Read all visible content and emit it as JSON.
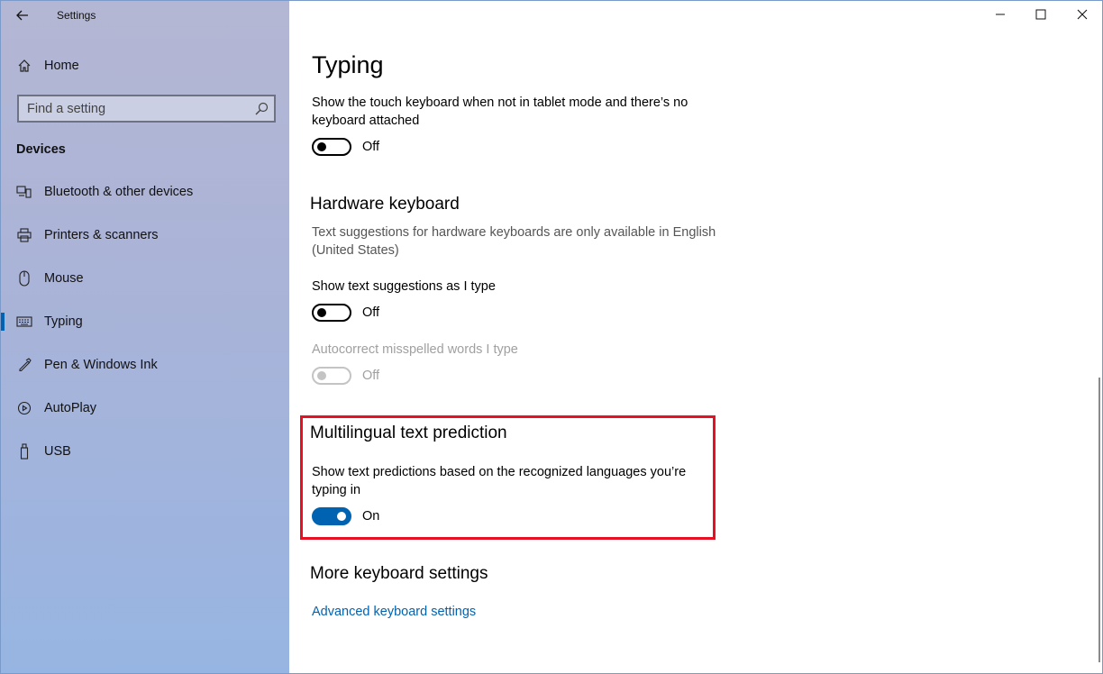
{
  "window": {
    "title": "Settings"
  },
  "sidebar": {
    "home_label": "Home",
    "search_placeholder": "Find a setting",
    "section": "Devices",
    "items": [
      {
        "label": "Bluetooth & other devices",
        "icon": "bluetooth-icon"
      },
      {
        "label": "Printers & scanners",
        "icon": "printer-icon"
      },
      {
        "label": "Mouse",
        "icon": "mouse-icon"
      },
      {
        "label": "Typing",
        "icon": "keyboard-icon",
        "active": true
      },
      {
        "label": "Pen & Windows Ink",
        "icon": "pen-icon"
      },
      {
        "label": "AutoPlay",
        "icon": "autoplay-icon"
      },
      {
        "label": "USB",
        "icon": "usb-icon"
      }
    ]
  },
  "content": {
    "title": "Typing",
    "touch_keyboard": {
      "description": "Show the touch keyboard when not in tablet mode and there’s no keyboard attached",
      "state": "Off"
    },
    "hardware_keyboard": {
      "heading": "Hardware keyboard",
      "note": "Text suggestions for hardware keyboards are only available in English (United States)",
      "suggestions_label": "Show text suggestions as I type",
      "suggestions_state": "Off",
      "autocorrect_label": "Autocorrect misspelled words I type",
      "autocorrect_state": "Off"
    },
    "multilingual": {
      "heading": "Multilingual text prediction",
      "description": "Show text predictions based on the recognized languages you’re typing in",
      "state": "On"
    },
    "more": {
      "heading": "More keyboard settings",
      "link": "Advanced keyboard settings"
    }
  },
  "colors": {
    "accent": "#0063b1",
    "highlight": "#e81123"
  }
}
